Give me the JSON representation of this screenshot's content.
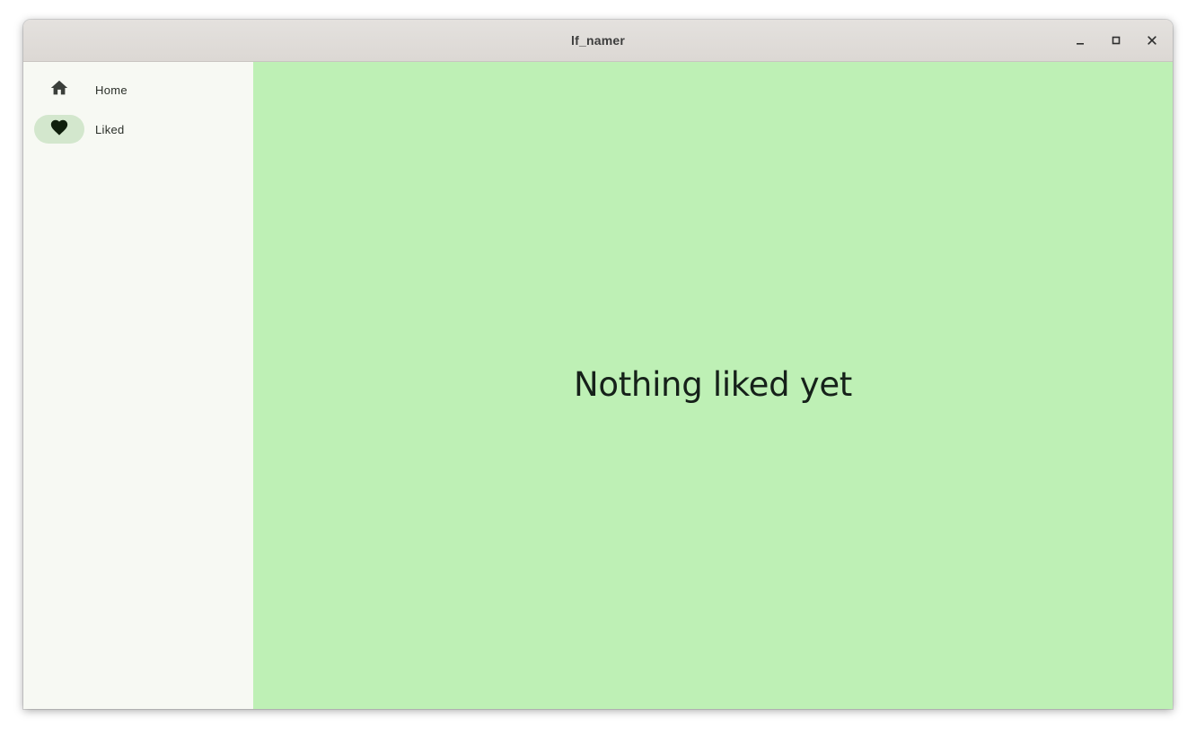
{
  "window": {
    "title": "lf_namer",
    "controls": {
      "minimize": "minimize-icon",
      "maximize": "maximize-icon",
      "close": "close-icon"
    }
  },
  "sidebar": {
    "items": [
      {
        "label": "Home",
        "icon": "home-icon",
        "selected": false
      },
      {
        "label": "Liked",
        "icon": "heart-icon",
        "selected": true
      }
    ]
  },
  "main": {
    "empty_message": "Nothing liked yet"
  },
  "colors": {
    "content_background": "#bef0b5",
    "sidebar_background": "#f7f9f3",
    "selected_indicator": "#d3e7cd",
    "titlebar": "#dfdbd7"
  }
}
